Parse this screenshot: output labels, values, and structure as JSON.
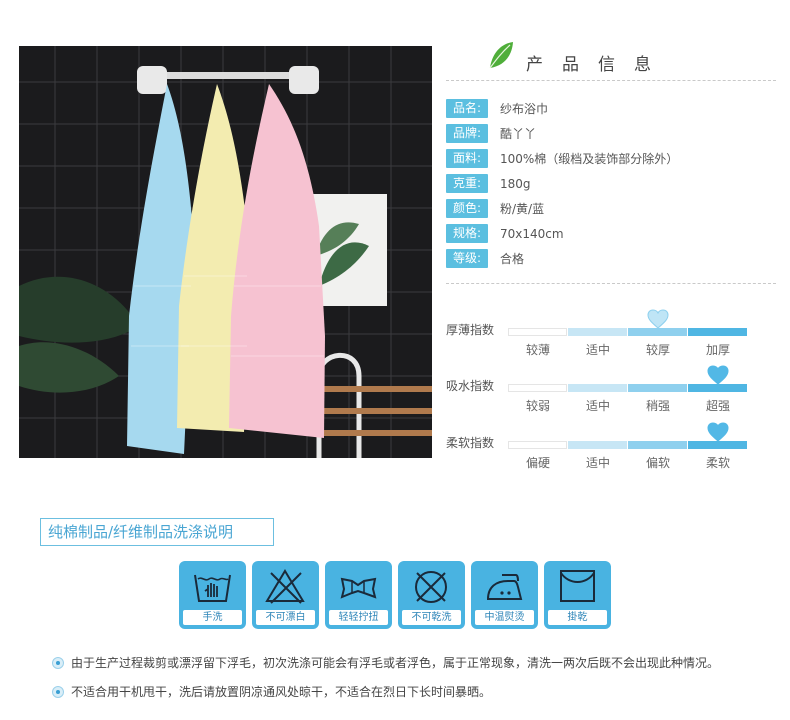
{
  "header": {
    "title": "产品信息",
    "leaf_icon": "leaf-icon"
  },
  "info": [
    {
      "label": "品名:",
      "value": "纱布浴巾"
    },
    {
      "label": "品牌:",
      "value": "酷丫丫"
    },
    {
      "label": "面料:",
      "value": "100%棉（缎档及装饰部分除外）"
    },
    {
      "label": "克重:",
      "value": "180g"
    },
    {
      "label": "颜色:",
      "value": "粉/黄/蓝"
    },
    {
      "label": "规格:",
      "value": "70x140cm"
    },
    {
      "label": "等级:",
      "value": "合格"
    }
  ],
  "indexes": [
    {
      "label": "厚薄指数",
      "options": [
        "较薄",
        "适中",
        "较厚",
        "加厚"
      ],
      "selected_index": 2,
      "heart_style": "outline"
    },
    {
      "label": "吸水指数",
      "options": [
        "较弱",
        "适中",
        "稍强",
        "超强"
      ],
      "selected_index": 3,
      "heart_style": "filled"
    },
    {
      "label": "柔软指数",
      "options": [
        "偏硬",
        "适中",
        "偏软",
        "柔软"
      ],
      "selected_index": 3,
      "heart_style": "filled"
    }
  ],
  "care": {
    "title": "纯棉制品/纤维制品洗涤说明",
    "icons": [
      {
        "name": "hand-wash-icon",
        "label": "手洗"
      },
      {
        "name": "no-bleach-icon",
        "label": "不可漂白"
      },
      {
        "name": "gentle-wring-icon",
        "label": "轻轻拧扭"
      },
      {
        "name": "no-dry-clean-icon",
        "label": "不可乾洗"
      },
      {
        "name": "medium-iron-icon",
        "label": "中温熨烫"
      },
      {
        "name": "hang-dry-icon",
        "label": "掛乾"
      }
    ]
  },
  "notes": [
    "由于生产过程裁剪或漂浮留下浮毛，初次洗涤可能会有浮毛或者浮色，属于正常现象，清洗一两次后既不会出现此种情况。",
    "不适合用干机甩干，洗后请放置阴凉通风处晾干，不适合在烈日下长时间暴晒。"
  ],
  "colors": {
    "accent": "#4fb6e3",
    "label_bg": "#5bbfe0",
    "heart": "#52b8e6",
    "towel_blue": "#9fd6ee",
    "towel_yellow": "#f2eaa6",
    "towel_pink": "#f5bccc"
  }
}
